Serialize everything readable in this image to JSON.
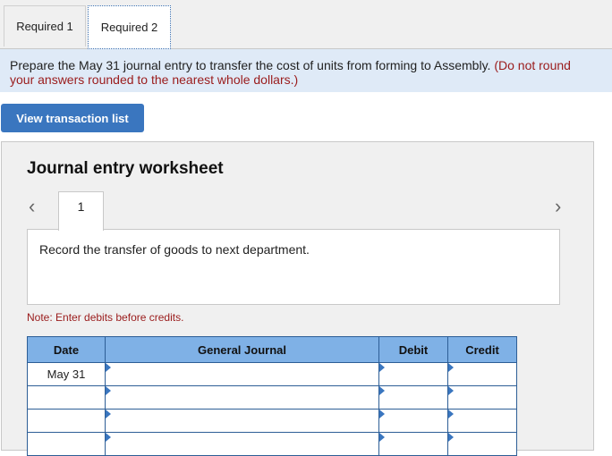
{
  "tabs": [
    {
      "label": "Required 1"
    },
    {
      "label": "Required 2"
    }
  ],
  "instructions": {
    "main": "Prepare the May 31 journal entry to transfer the cost of units from forming to Assembly.",
    "red": "(Do not round",
    "line2": "your answers rounded to the nearest whole dollars.)"
  },
  "view_button": "View transaction list",
  "worksheet": {
    "title": "Journal entry worksheet",
    "page_tab": "1",
    "record_text": "Record the transfer of goods to next department.",
    "note": "Note: Enter debits before credits."
  },
  "table": {
    "headers": {
      "date": "Date",
      "journal": "General Journal",
      "debit": "Debit",
      "credit": "Credit"
    },
    "rows": [
      {
        "date": "May 31",
        "journal": "",
        "debit": "",
        "credit": ""
      },
      {
        "date": "",
        "journal": "",
        "debit": "",
        "credit": ""
      },
      {
        "date": "",
        "journal": "",
        "debit": "",
        "credit": ""
      },
      {
        "date": "",
        "journal": "",
        "debit": "",
        "credit": ""
      }
    ]
  },
  "icons": {
    "prev": "chevron-left-icon",
    "next": "chevron-right-icon"
  },
  "colors": {
    "accent": "#3a76bf",
    "header_bg": "#7fb1e6",
    "note_red": "#9a1b1b",
    "instr_bg": "#dfeaf7"
  }
}
